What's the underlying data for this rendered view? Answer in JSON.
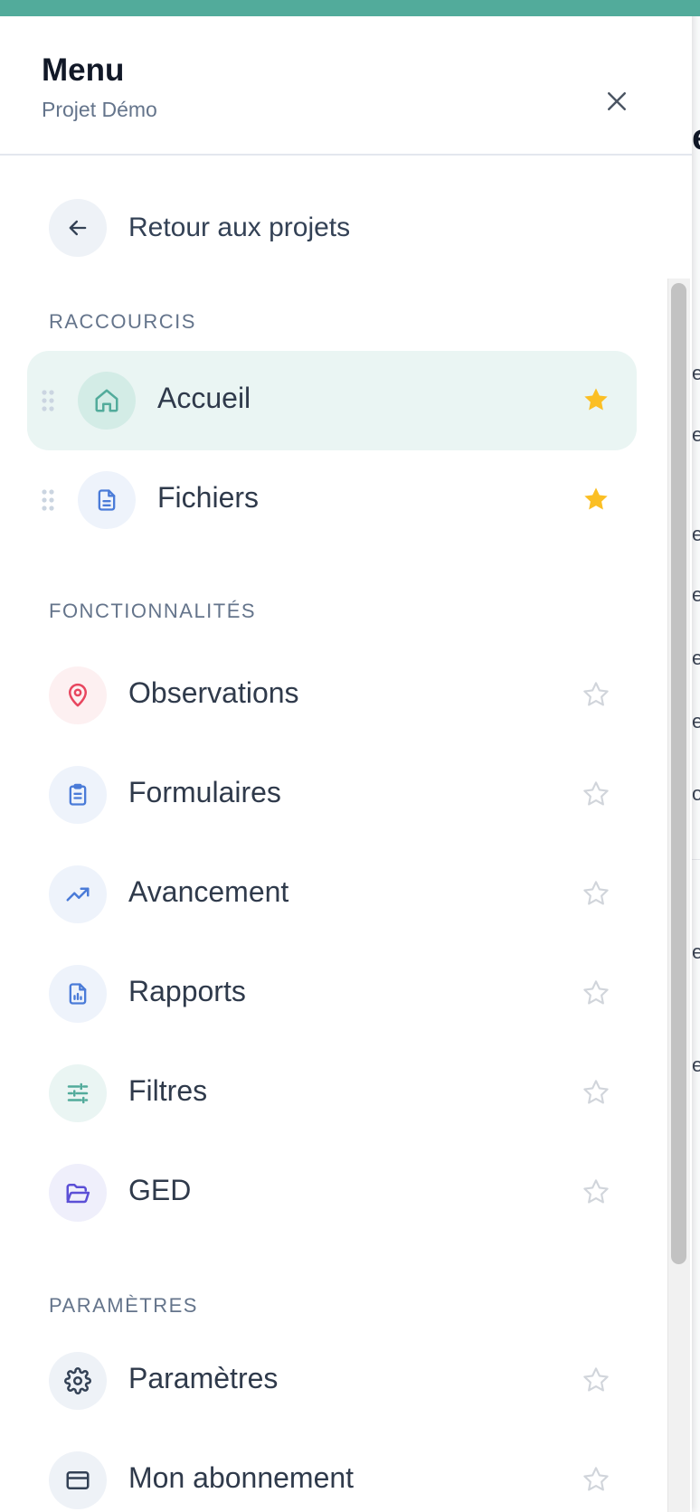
{
  "header": {
    "title": "Menu",
    "subtitle": "Projet Démo"
  },
  "back": {
    "label": "Retour aux projets"
  },
  "sections": {
    "shortcuts": "RACCOURCIS",
    "features": "FONCTIONNALITÉS",
    "settings": "PARAMÈTRES"
  },
  "shortcuts": [
    {
      "label": "Accueil",
      "icon": "home-icon",
      "active": true,
      "favorite": true
    },
    {
      "label": "Fichiers",
      "icon": "file-icon",
      "active": false,
      "favorite": true
    }
  ],
  "features": [
    {
      "label": "Observations",
      "icon": "map-pin-icon",
      "favorite": false
    },
    {
      "label": "Formulaires",
      "icon": "clipboard-icon",
      "favorite": false
    },
    {
      "label": "Avancement",
      "icon": "trending-up-icon",
      "favorite": false
    },
    {
      "label": "Rapports",
      "icon": "report-icon",
      "favorite": false
    },
    {
      "label": "Filtres",
      "icon": "sliders-icon",
      "favorite": false
    },
    {
      "label": "GED",
      "icon": "folder-open-icon",
      "favorite": false
    }
  ],
  "settings": [
    {
      "label": "Paramètres",
      "icon": "gear-icon",
      "favorite": false
    },
    {
      "label": "Mon abonnement",
      "icon": "credit-card-icon",
      "favorite": false
    }
  ],
  "colors": {
    "accent": "#52ab9b",
    "star_active": "#fbbf24",
    "star_inactive": "#d1d5db",
    "text": "#2f3a4b",
    "muted": "#64748b"
  }
}
